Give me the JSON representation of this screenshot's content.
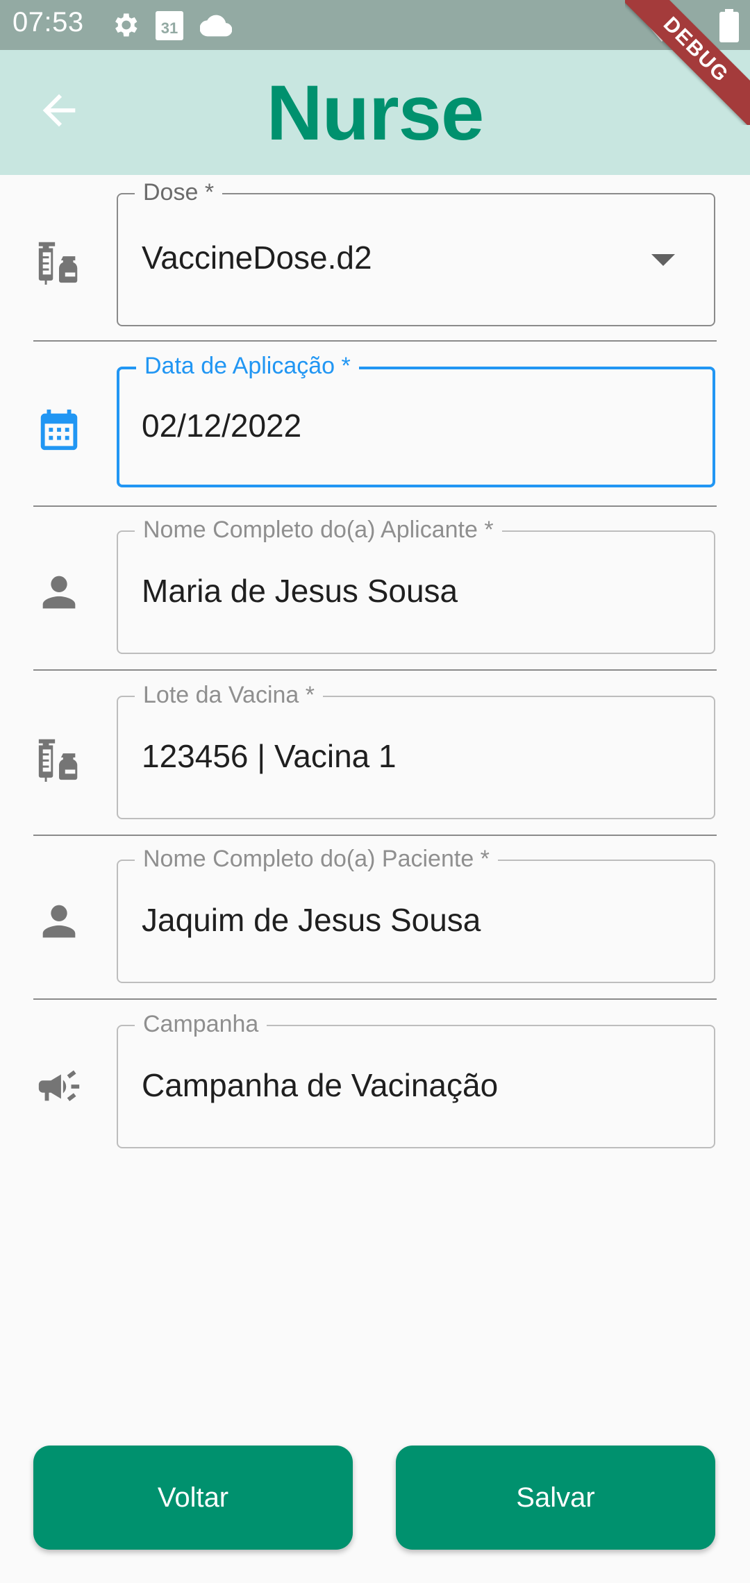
{
  "status_bar": {
    "time": "07:53",
    "calendar_day": "31",
    "icons": [
      "gear-icon",
      "calendar-icon",
      "cloud-icon",
      "wifi-icon",
      "battery-icon"
    ]
  },
  "app_bar": {
    "title": "Nurse",
    "back_icon": "arrow-back-icon",
    "debug_banner": "DEBUG"
  },
  "form": {
    "dose": {
      "label": "Dose *",
      "value": "VaccineDose.d2",
      "icon": "vaccine-icon"
    },
    "application_date": {
      "label": "Data de Aplicação *",
      "value": "02/12/2022",
      "icon": "calendar-icon"
    },
    "applicant_name": {
      "label": "Nome Completo do(a) Aplicante *",
      "value": "Maria de Jesus Sousa",
      "icon": "person-icon"
    },
    "vaccine_lot": {
      "label": "Lote da Vacina *",
      "value": "123456 | Vacina 1",
      "icon": "vaccine-icon"
    },
    "patient_name": {
      "label": "Nome Completo do(a) Paciente *",
      "value": "Jaquim de Jesus Sousa",
      "icon": "person-icon"
    },
    "campaign": {
      "label": "Campanha",
      "value": "Campanha de Vacinação",
      "icon": "campaign-icon"
    }
  },
  "actions": {
    "back_label": "Voltar",
    "save_label": "Salvar"
  },
  "colors": {
    "primary": "#00916e",
    "app_bar": "#c8e6e0",
    "status_bar": "#93aaa3",
    "focus": "#2196f3",
    "debug": "#a43b3b"
  }
}
